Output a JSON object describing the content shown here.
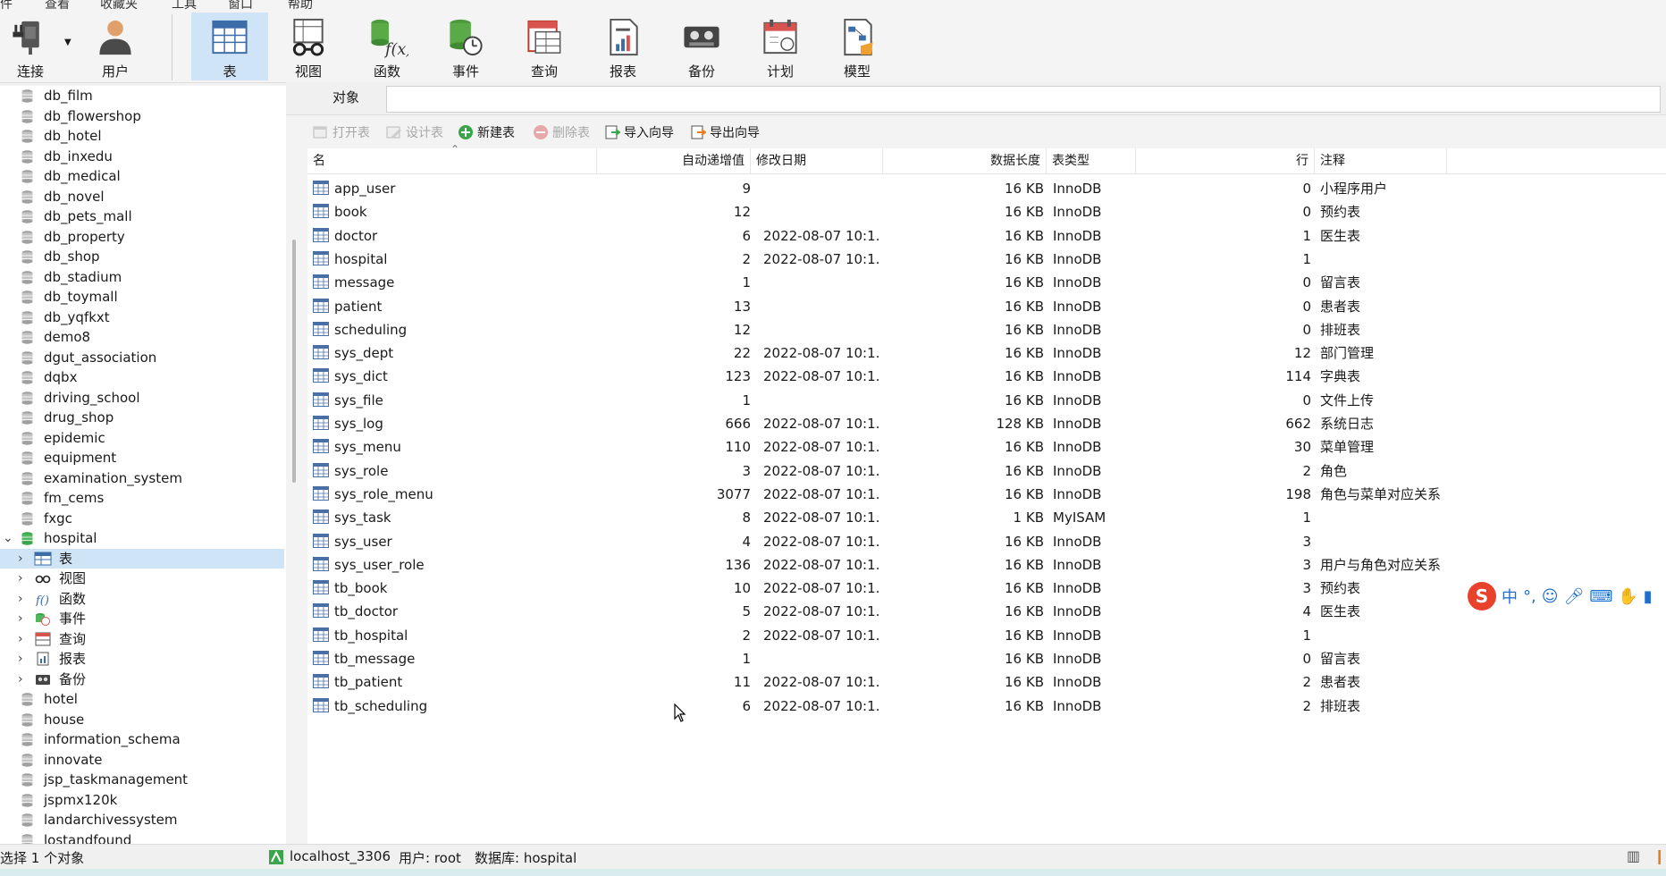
{
  "colors": {
    "accent": "#cfe4f7",
    "db_icon_gray": "#9a9a9a",
    "db_icon_green": "#3aa54a",
    "ime_red": "#e8412c",
    "ime_blue": "#1f6fd1"
  },
  "menu_partial": [
    "件",
    "查看",
    "收藏夹",
    "工具",
    "窗口",
    "帮助"
  ],
  "toolbar": {
    "buttons": [
      {
        "label": "连接",
        "icon": "plug-icon"
      },
      {
        "label": "用户",
        "icon": "user-icon"
      },
      {
        "label": "表",
        "icon": "table-icon"
      },
      {
        "label": "视图",
        "icon": "glasses-icon"
      },
      {
        "label": "函数",
        "icon": "function-icon"
      },
      {
        "label": "事件",
        "icon": "event-icon"
      },
      {
        "label": "查询",
        "icon": "query-icon"
      },
      {
        "label": "报表",
        "icon": "report-icon"
      },
      {
        "label": "备份",
        "icon": "backup-icon"
      },
      {
        "label": "计划",
        "icon": "calendar-icon"
      },
      {
        "label": "模型",
        "icon": "model-icon"
      }
    ]
  },
  "tree": {
    "databases_before": [
      "db_film",
      "db_flowershop",
      "db_hotel",
      "db_inxedu",
      "db_medical",
      "db_novel",
      "db_pets_mall",
      "db_property",
      "db_shop",
      "db_stadium",
      "db_toymall",
      "db_yqfkxt",
      "demo8",
      "dgut_association",
      "dqbx",
      "driving_school",
      "drug_shop",
      "epidemic",
      "equipment",
      "examination_system",
      "fm_cems",
      "fxgc"
    ],
    "open_db": "hospital",
    "children": [
      "表",
      "视图",
      "函数",
      "事件",
      "查询",
      "报表",
      "备份"
    ],
    "databases_after": [
      "hotel",
      "house",
      "information_schema",
      "innovate",
      "jsp_taskmanagement",
      "jspmx120k",
      "landarchivessystem",
      "lostandfound"
    ]
  },
  "objects_tab": "对象",
  "actions": {
    "open": "打开表",
    "design": "设计表",
    "new": "新建表",
    "delete": "删除表",
    "import": "导入向导",
    "export": "导出向导"
  },
  "columns": {
    "name": "名",
    "auto_inc": "自动递增值",
    "modified": "修改日期",
    "data_len": "数据长度",
    "type": "表类型",
    "rows": "行",
    "comment": "注释"
  },
  "rows": [
    {
      "name": "app_user",
      "auto": "9",
      "date": "",
      "len": "16 KB",
      "type": "InnoDB",
      "rows": "0",
      "comment": "小程序用户"
    },
    {
      "name": "book",
      "auto": "12",
      "date": "",
      "len": "16 KB",
      "type": "InnoDB",
      "rows": "0",
      "comment": "预约表"
    },
    {
      "name": "doctor",
      "auto": "6",
      "date": "2022-08-07 10:1...",
      "len": "16 KB",
      "type": "InnoDB",
      "rows": "1",
      "comment": "医生表"
    },
    {
      "name": "hospital",
      "auto": "2",
      "date": "2022-08-07 10:1...",
      "len": "16 KB",
      "type": "InnoDB",
      "rows": "1",
      "comment": ""
    },
    {
      "name": "message",
      "auto": "1",
      "date": "",
      "len": "16 KB",
      "type": "InnoDB",
      "rows": "0",
      "comment": "留言表"
    },
    {
      "name": "patient",
      "auto": "13",
      "date": "",
      "len": "16 KB",
      "type": "InnoDB",
      "rows": "0",
      "comment": "患者表"
    },
    {
      "name": "scheduling",
      "auto": "12",
      "date": "",
      "len": "16 KB",
      "type": "InnoDB",
      "rows": "0",
      "comment": "排班表"
    },
    {
      "name": "sys_dept",
      "auto": "22",
      "date": "2022-08-07 10:1...",
      "len": "16 KB",
      "type": "InnoDB",
      "rows": "12",
      "comment": "部门管理"
    },
    {
      "name": "sys_dict",
      "auto": "123",
      "date": "2022-08-07 10:1...",
      "len": "16 KB",
      "type": "InnoDB",
      "rows": "114",
      "comment": "字典表"
    },
    {
      "name": "sys_file",
      "auto": "1",
      "date": "",
      "len": "16 KB",
      "type": "InnoDB",
      "rows": "0",
      "comment": "文件上传"
    },
    {
      "name": "sys_log",
      "auto": "666",
      "date": "2022-08-07 10:1...",
      "len": "128 KB",
      "type": "InnoDB",
      "rows": "662",
      "comment": "系统日志"
    },
    {
      "name": "sys_menu",
      "auto": "110",
      "date": "2022-08-07 10:1...",
      "len": "16 KB",
      "type": "InnoDB",
      "rows": "30",
      "comment": "菜单管理"
    },
    {
      "name": "sys_role",
      "auto": "3",
      "date": "2022-08-07 10:1...",
      "len": "16 KB",
      "type": "InnoDB",
      "rows": "2",
      "comment": "角色"
    },
    {
      "name": "sys_role_menu",
      "auto": "3077",
      "date": "2022-08-07 10:1...",
      "len": "16 KB",
      "type": "InnoDB",
      "rows": "198",
      "comment": "角色与菜单对应关系"
    },
    {
      "name": "sys_task",
      "auto": "8",
      "date": "2022-08-07 10:1...",
      "len": "1 KB",
      "type": "MyISAM",
      "rows": "1",
      "comment": ""
    },
    {
      "name": "sys_user",
      "auto": "4",
      "date": "2022-08-07 10:1...",
      "len": "16 KB",
      "type": "InnoDB",
      "rows": "3",
      "comment": ""
    },
    {
      "name": "sys_user_role",
      "auto": "136",
      "date": "2022-08-07 10:1...",
      "len": "16 KB",
      "type": "InnoDB",
      "rows": "3",
      "comment": "用户与角色对应关系"
    },
    {
      "name": "tb_book",
      "auto": "10",
      "date": "2022-08-07 10:1...",
      "len": "16 KB",
      "type": "InnoDB",
      "rows": "3",
      "comment": "预约表"
    },
    {
      "name": "tb_doctor",
      "auto": "5",
      "date": "2022-08-07 10:1...",
      "len": "16 KB",
      "type": "InnoDB",
      "rows": "4",
      "comment": "医生表"
    },
    {
      "name": "tb_hospital",
      "auto": "2",
      "date": "2022-08-07 10:1...",
      "len": "16 KB",
      "type": "InnoDB",
      "rows": "1",
      "comment": ""
    },
    {
      "name": "tb_message",
      "auto": "1",
      "date": "",
      "len": "16 KB",
      "type": "InnoDB",
      "rows": "0",
      "comment": "留言表"
    },
    {
      "name": "tb_patient",
      "auto": "11",
      "date": "2022-08-07 10:1...",
      "len": "16 KB",
      "type": "InnoDB",
      "rows": "2",
      "comment": "患者表"
    },
    {
      "name": "tb_scheduling",
      "auto": "6",
      "date": "2022-08-07 10:1...",
      "len": "16 KB",
      "type": "InnoDB",
      "rows": "2",
      "comment": "排班表"
    }
  ],
  "status": {
    "selection": "选择 1 个对象",
    "connection": "localhost_3306",
    "user": "用户: root",
    "database": "数据库: hospital"
  },
  "ime": {
    "logo": "S",
    "mode": "中",
    "punct": "°,"
  }
}
